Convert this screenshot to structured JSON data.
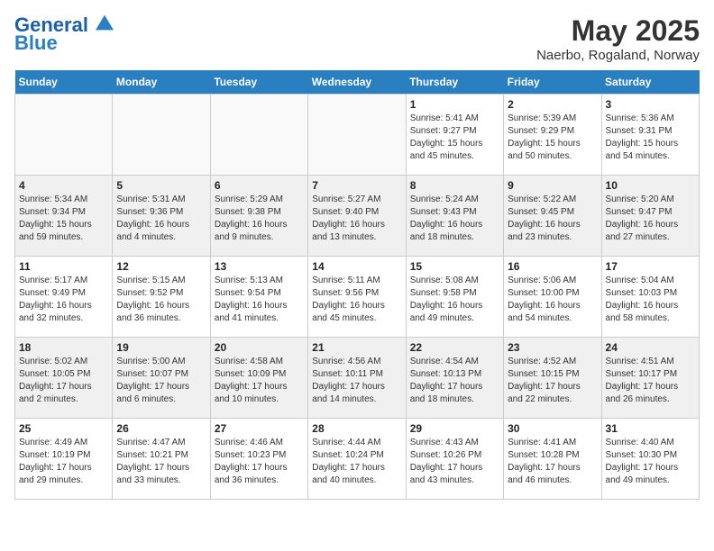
{
  "logo": {
    "line1": "General",
    "line2": "Blue"
  },
  "title": "May 2025",
  "location": "Naerbo, Rogaland, Norway",
  "days_of_week": [
    "Sunday",
    "Monday",
    "Tuesday",
    "Wednesday",
    "Thursday",
    "Friday",
    "Saturday"
  ],
  "weeks": [
    [
      {
        "day": "",
        "info": ""
      },
      {
        "day": "",
        "info": ""
      },
      {
        "day": "",
        "info": ""
      },
      {
        "day": "",
        "info": ""
      },
      {
        "day": "1",
        "info": "Sunrise: 5:41 AM\nSunset: 9:27 PM\nDaylight: 15 hours\nand 45 minutes."
      },
      {
        "day": "2",
        "info": "Sunrise: 5:39 AM\nSunset: 9:29 PM\nDaylight: 15 hours\nand 50 minutes."
      },
      {
        "day": "3",
        "info": "Sunrise: 5:36 AM\nSunset: 9:31 PM\nDaylight: 15 hours\nand 54 minutes."
      }
    ],
    [
      {
        "day": "4",
        "info": "Sunrise: 5:34 AM\nSunset: 9:34 PM\nDaylight: 15 hours\nand 59 minutes."
      },
      {
        "day": "5",
        "info": "Sunrise: 5:31 AM\nSunset: 9:36 PM\nDaylight: 16 hours\nand 4 minutes."
      },
      {
        "day": "6",
        "info": "Sunrise: 5:29 AM\nSunset: 9:38 PM\nDaylight: 16 hours\nand 9 minutes."
      },
      {
        "day": "7",
        "info": "Sunrise: 5:27 AM\nSunset: 9:40 PM\nDaylight: 16 hours\nand 13 minutes."
      },
      {
        "day": "8",
        "info": "Sunrise: 5:24 AM\nSunset: 9:43 PM\nDaylight: 16 hours\nand 18 minutes."
      },
      {
        "day": "9",
        "info": "Sunrise: 5:22 AM\nSunset: 9:45 PM\nDaylight: 16 hours\nand 23 minutes."
      },
      {
        "day": "10",
        "info": "Sunrise: 5:20 AM\nSunset: 9:47 PM\nDaylight: 16 hours\nand 27 minutes."
      }
    ],
    [
      {
        "day": "11",
        "info": "Sunrise: 5:17 AM\nSunset: 9:49 PM\nDaylight: 16 hours\nand 32 minutes."
      },
      {
        "day": "12",
        "info": "Sunrise: 5:15 AM\nSunset: 9:52 PM\nDaylight: 16 hours\nand 36 minutes."
      },
      {
        "day": "13",
        "info": "Sunrise: 5:13 AM\nSunset: 9:54 PM\nDaylight: 16 hours\nand 41 minutes."
      },
      {
        "day": "14",
        "info": "Sunrise: 5:11 AM\nSunset: 9:56 PM\nDaylight: 16 hours\nand 45 minutes."
      },
      {
        "day": "15",
        "info": "Sunrise: 5:08 AM\nSunset: 9:58 PM\nDaylight: 16 hours\nand 49 minutes."
      },
      {
        "day": "16",
        "info": "Sunrise: 5:06 AM\nSunset: 10:00 PM\nDaylight: 16 hours\nand 54 minutes."
      },
      {
        "day": "17",
        "info": "Sunrise: 5:04 AM\nSunset: 10:03 PM\nDaylight: 16 hours\nand 58 minutes."
      }
    ],
    [
      {
        "day": "18",
        "info": "Sunrise: 5:02 AM\nSunset: 10:05 PM\nDaylight: 17 hours\nand 2 minutes."
      },
      {
        "day": "19",
        "info": "Sunrise: 5:00 AM\nSunset: 10:07 PM\nDaylight: 17 hours\nand 6 minutes."
      },
      {
        "day": "20",
        "info": "Sunrise: 4:58 AM\nSunset: 10:09 PM\nDaylight: 17 hours\nand 10 minutes."
      },
      {
        "day": "21",
        "info": "Sunrise: 4:56 AM\nSunset: 10:11 PM\nDaylight: 17 hours\nand 14 minutes."
      },
      {
        "day": "22",
        "info": "Sunrise: 4:54 AM\nSunset: 10:13 PM\nDaylight: 17 hours\nand 18 minutes."
      },
      {
        "day": "23",
        "info": "Sunrise: 4:52 AM\nSunset: 10:15 PM\nDaylight: 17 hours\nand 22 minutes."
      },
      {
        "day": "24",
        "info": "Sunrise: 4:51 AM\nSunset: 10:17 PM\nDaylight: 17 hours\nand 26 minutes."
      }
    ],
    [
      {
        "day": "25",
        "info": "Sunrise: 4:49 AM\nSunset: 10:19 PM\nDaylight: 17 hours\nand 29 minutes."
      },
      {
        "day": "26",
        "info": "Sunrise: 4:47 AM\nSunset: 10:21 PM\nDaylight: 17 hours\nand 33 minutes."
      },
      {
        "day": "27",
        "info": "Sunrise: 4:46 AM\nSunset: 10:23 PM\nDaylight: 17 hours\nand 36 minutes."
      },
      {
        "day": "28",
        "info": "Sunrise: 4:44 AM\nSunset: 10:24 PM\nDaylight: 17 hours\nand 40 minutes."
      },
      {
        "day": "29",
        "info": "Sunrise: 4:43 AM\nSunset: 10:26 PM\nDaylight: 17 hours\nand 43 minutes."
      },
      {
        "day": "30",
        "info": "Sunrise: 4:41 AM\nSunset: 10:28 PM\nDaylight: 17 hours\nand 46 minutes."
      },
      {
        "day": "31",
        "info": "Sunrise: 4:40 AM\nSunset: 10:30 PM\nDaylight: 17 hours\nand 49 minutes."
      }
    ]
  ]
}
